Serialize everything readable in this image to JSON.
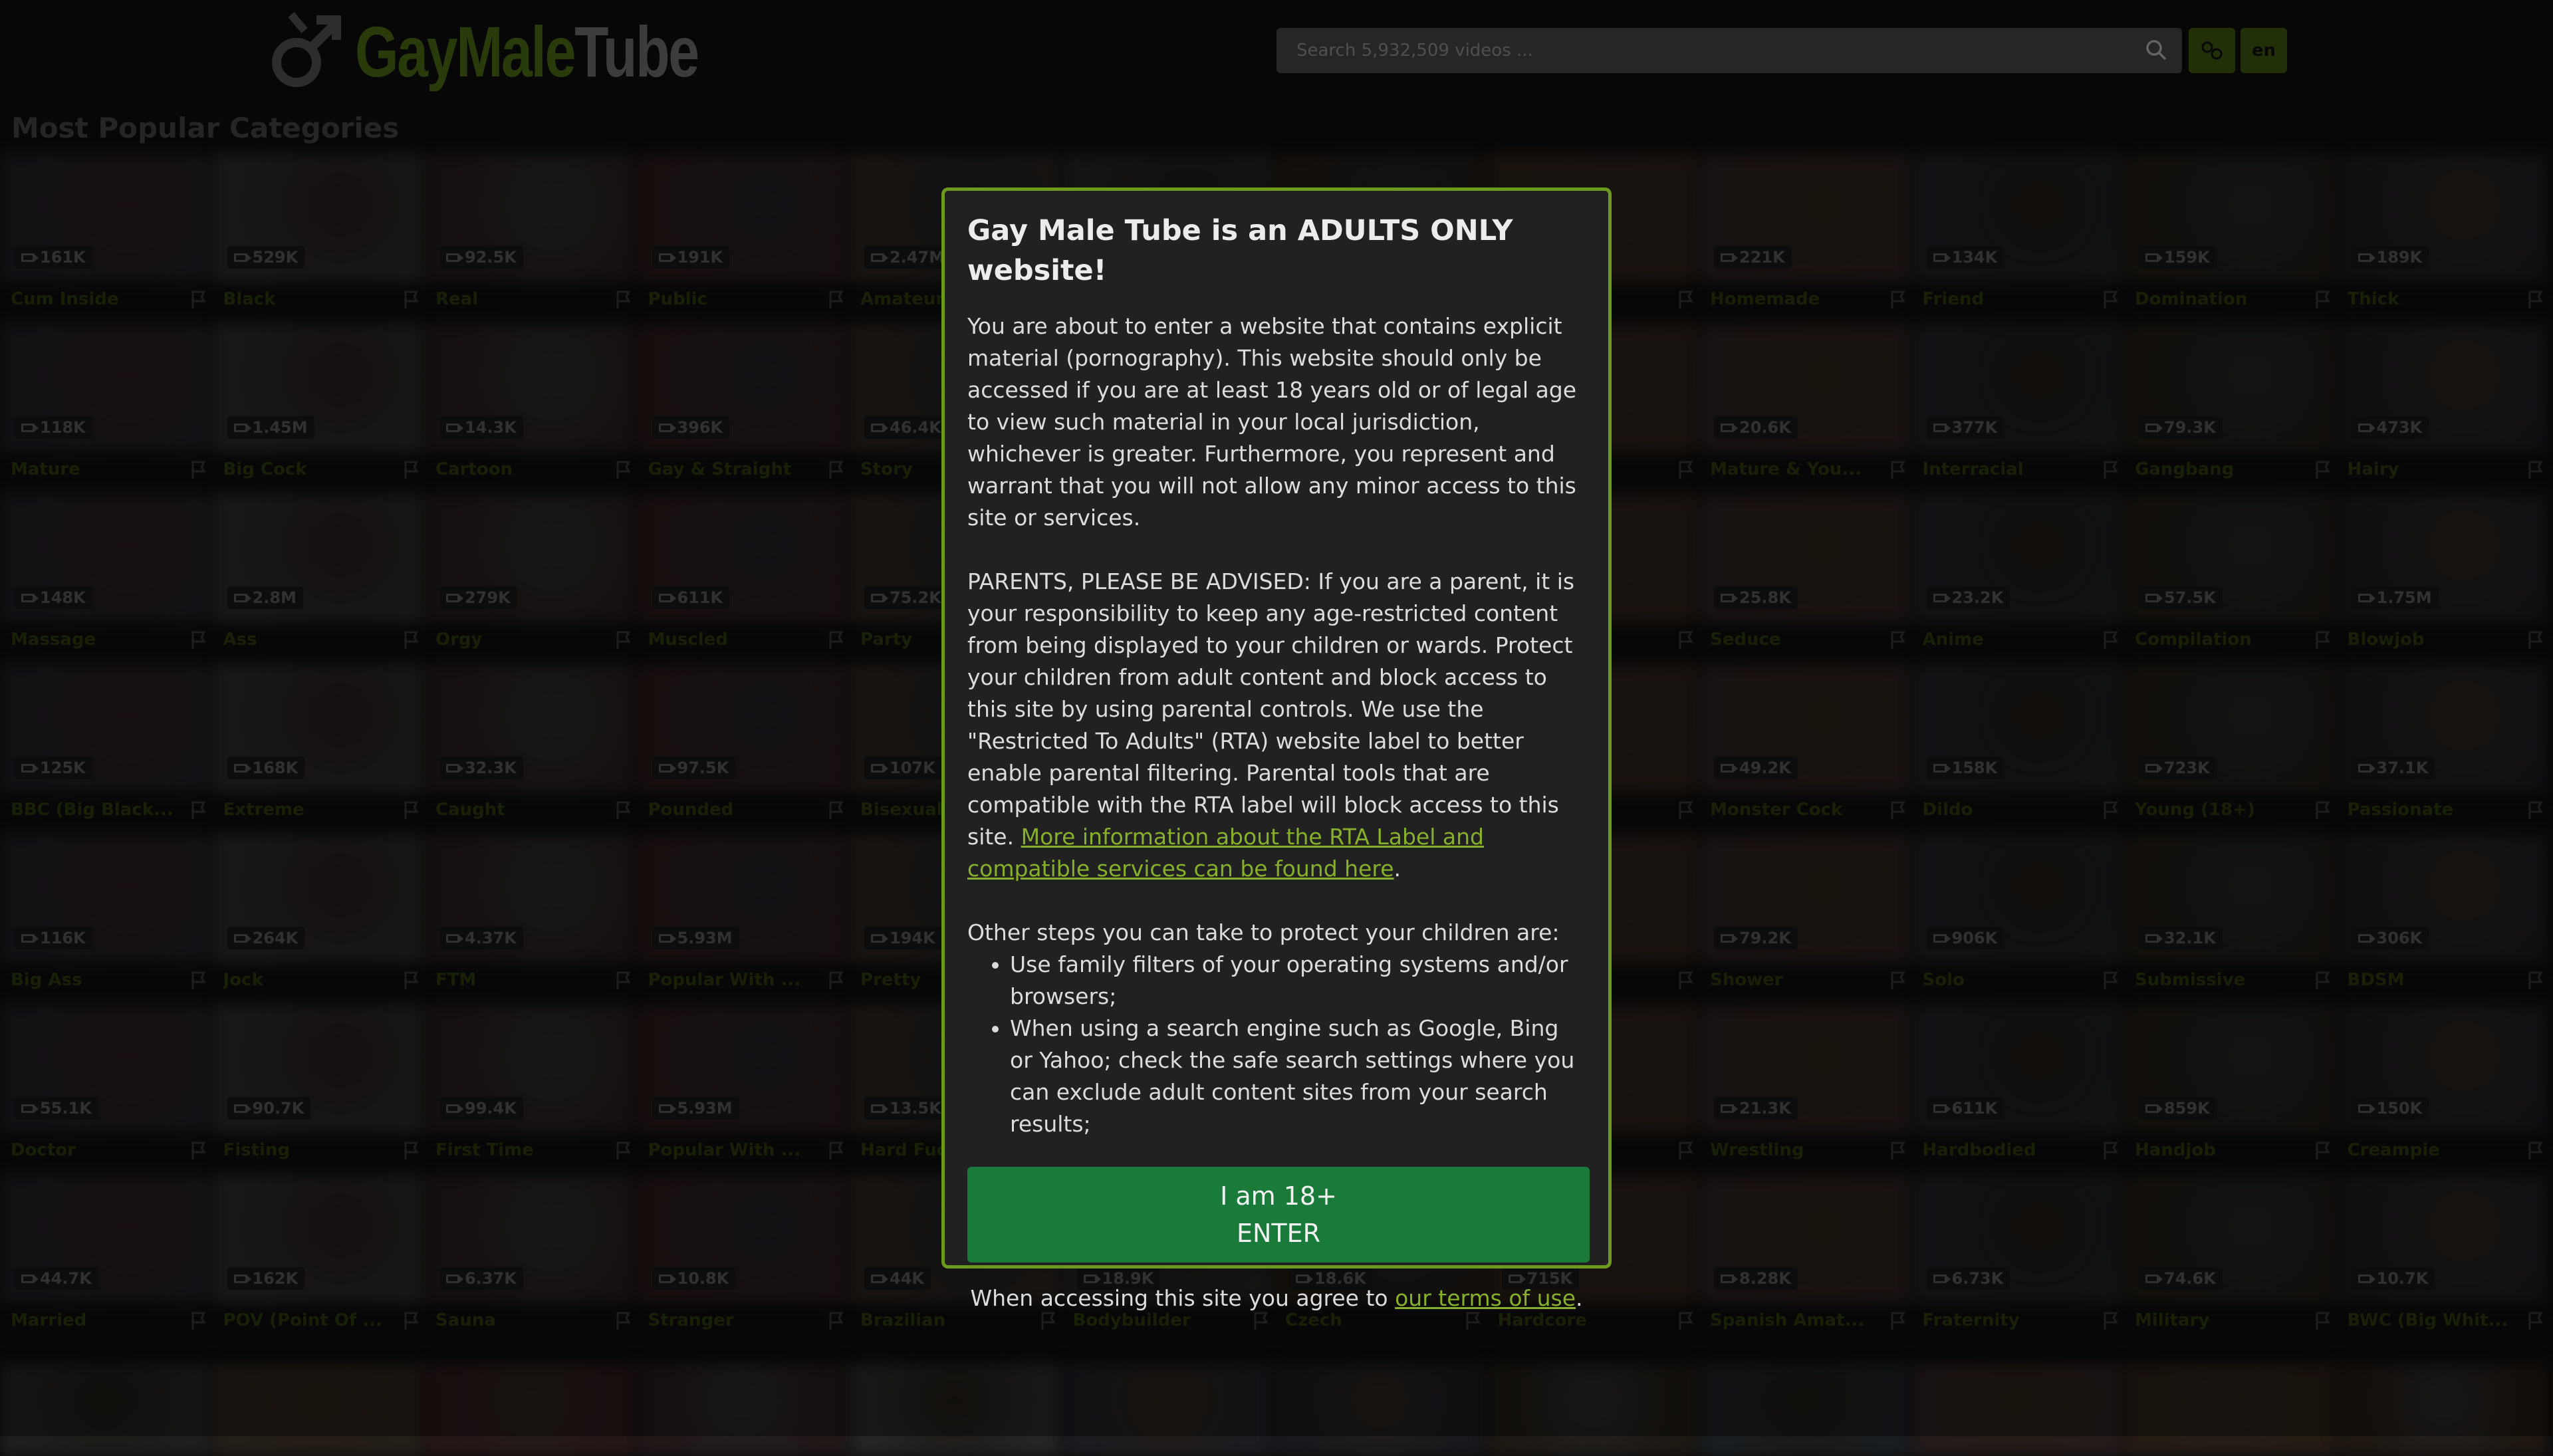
{
  "header": {
    "logo": {
      "gay_male": "GayMale",
      "tube": "Tube"
    },
    "search_placeholder": "Search 5,932,509 videos ...",
    "lang_button": "en"
  },
  "page_title": "Most Popular Categories",
  "colors": {
    "accent": "#6b9a1c",
    "enter_button": "#1a7a3a",
    "link": "#86b02c"
  },
  "categories": [
    {
      "name": "Cum Inside",
      "count": "161K"
    },
    {
      "name": "Black",
      "count": "529K"
    },
    {
      "name": "Real",
      "count": "92.5K"
    },
    {
      "name": "Public",
      "count": "191K"
    },
    {
      "name": "Amateur",
      "count": "2.47M"
    },
    {
      "name": "",
      "count": ""
    },
    {
      "name": "",
      "count": ""
    },
    {
      "name": "(...",
      "count": ""
    },
    {
      "name": "Homemade",
      "count": "221K"
    },
    {
      "name": "Friend",
      "count": "134K"
    },
    {
      "name": "Domination",
      "count": "159K"
    },
    {
      "name": "Thick",
      "count": "189K"
    },
    {
      "name": "Mature",
      "count": "118K"
    },
    {
      "name": "Big Cock",
      "count": "1.45M"
    },
    {
      "name": "Cartoon",
      "count": "14.3K"
    },
    {
      "name": "Gay & Straight",
      "count": "396K"
    },
    {
      "name": "Story",
      "count": "46.4K"
    },
    {
      "name": "",
      "count": ""
    },
    {
      "name": "",
      "count": ""
    },
    {
      "name": "",
      "count": ""
    },
    {
      "name": "Mature & You...",
      "count": "20.6K"
    },
    {
      "name": "Interracial",
      "count": "377K"
    },
    {
      "name": "Gangbang",
      "count": "79.3K"
    },
    {
      "name": "Hairy",
      "count": "473K"
    },
    {
      "name": "Massage",
      "count": "148K"
    },
    {
      "name": "Ass",
      "count": "2.8M"
    },
    {
      "name": "Orgy",
      "count": "279K"
    },
    {
      "name": "Muscled",
      "count": "611K"
    },
    {
      "name": "Party",
      "count": "75.2K"
    },
    {
      "name": "",
      "count": ""
    },
    {
      "name": "",
      "count": ""
    },
    {
      "name": "",
      "count": ""
    },
    {
      "name": "Seduce",
      "count": "25.8K"
    },
    {
      "name": "Anime",
      "count": "23.2K"
    },
    {
      "name": "Compilation",
      "count": "57.5K"
    },
    {
      "name": "Blowjob",
      "count": "1.75M"
    },
    {
      "name": "BBC (Big Black...",
      "count": "125K"
    },
    {
      "name": "Extreme",
      "count": "168K"
    },
    {
      "name": "Caught",
      "count": "32.3K"
    },
    {
      "name": "Pounded",
      "count": "97.5K"
    },
    {
      "name": "Bisexual",
      "count": "107K"
    },
    {
      "name": "",
      "count": ""
    },
    {
      "name": "",
      "count": ""
    },
    {
      "name": "",
      "count": ""
    },
    {
      "name": "Monster Cock",
      "count": "49.2K"
    },
    {
      "name": "Dildo",
      "count": "158K"
    },
    {
      "name": "Young (18+)",
      "count": "723K"
    },
    {
      "name": "Passionate",
      "count": "37.1K"
    },
    {
      "name": "Big Ass",
      "count": "116K"
    },
    {
      "name": "Jock",
      "count": "264K"
    },
    {
      "name": "FTM",
      "count": "4.37K"
    },
    {
      "name": "Popular With ...",
      "count": "5.93M"
    },
    {
      "name": "Pretty",
      "count": "194K"
    },
    {
      "name": "",
      "count": ""
    },
    {
      "name": "",
      "count": ""
    },
    {
      "name": "",
      "count": ""
    },
    {
      "name": "Shower",
      "count": "79.2K"
    },
    {
      "name": "Solo",
      "count": "906K"
    },
    {
      "name": "Submissive",
      "count": "32.1K"
    },
    {
      "name": "BDSM",
      "count": "306K"
    },
    {
      "name": "Doctor",
      "count": "55.1K"
    },
    {
      "name": "Fisting",
      "count": "90.7K"
    },
    {
      "name": "First Time",
      "count": "99.4K"
    },
    {
      "name": "Popular With ...",
      "count": "5.93M"
    },
    {
      "name": "Hard Fuc",
      "count": "13.5K"
    },
    {
      "name": "",
      "count": ""
    },
    {
      "name": "",
      "count": ""
    },
    {
      "name": "",
      "count": ""
    },
    {
      "name": "Wrestling",
      "count": "21.3K"
    },
    {
      "name": "Hardbodied",
      "count": "611K"
    },
    {
      "name": "Handjob",
      "count": "859K"
    },
    {
      "name": "Creampie",
      "count": "150K"
    },
    {
      "name": "Married",
      "count": "44.7K"
    },
    {
      "name": "POV (Point Of ...",
      "count": "162K"
    },
    {
      "name": "Sauna",
      "count": "6.37K"
    },
    {
      "name": "Stranger",
      "count": "10.8K"
    },
    {
      "name": "Brazilian",
      "count": "44K"
    },
    {
      "name": "Bodybuilder",
      "count": "18.9K"
    },
    {
      "name": "Czech",
      "count": "18.6K"
    },
    {
      "name": "Hardcore",
      "count": "715K"
    },
    {
      "name": "Spanish Amat...",
      "count": "8.28K"
    },
    {
      "name": "Fraternity",
      "count": "6.73K"
    },
    {
      "name": "Military",
      "count": "74.6K"
    },
    {
      "name": "BWC (Big Whit...",
      "count": "10.7K"
    }
  ],
  "modal": {
    "title": "Gay Male Tube is an ADULTS ONLY website!",
    "p1": "You are about to enter a website that contains explicit material (pornography). This website should only be accessed if you are at least 18 years old or of legal age to view such material in your local jurisdiction, whichever is greater. Furthermore, you represent and warrant that you will not allow any minor access to this site or services.",
    "p2": "PARENTS, PLEASE BE ADVISED: If you are a parent, it is your responsibility to keep any age-restricted content from being displayed to your children or wards. Protect your children from adult content and block access to this site by using parental controls. We use the \"Restricted To Adults\" (RTA) website label to better enable parental filtering. Parental tools that are compatible with the RTA label will block access to this site.",
    "rta_link": "More information about the RTA Label and compatible services can be found here",
    "p3": "Other steps you can take to protect your children are:",
    "steps": [
      "Use family filters of your operating systems and/or browsers;",
      "When using a search engine such as Google, Bing or Yahoo; check the safe search settings where you can exclude adult content sites from your search results;"
    ],
    "enter_line1": "I am 18+",
    "enter_line2": "ENTER",
    "terms_prefix": "When accessing this site you agree to",
    "terms_link": "our terms of use"
  }
}
